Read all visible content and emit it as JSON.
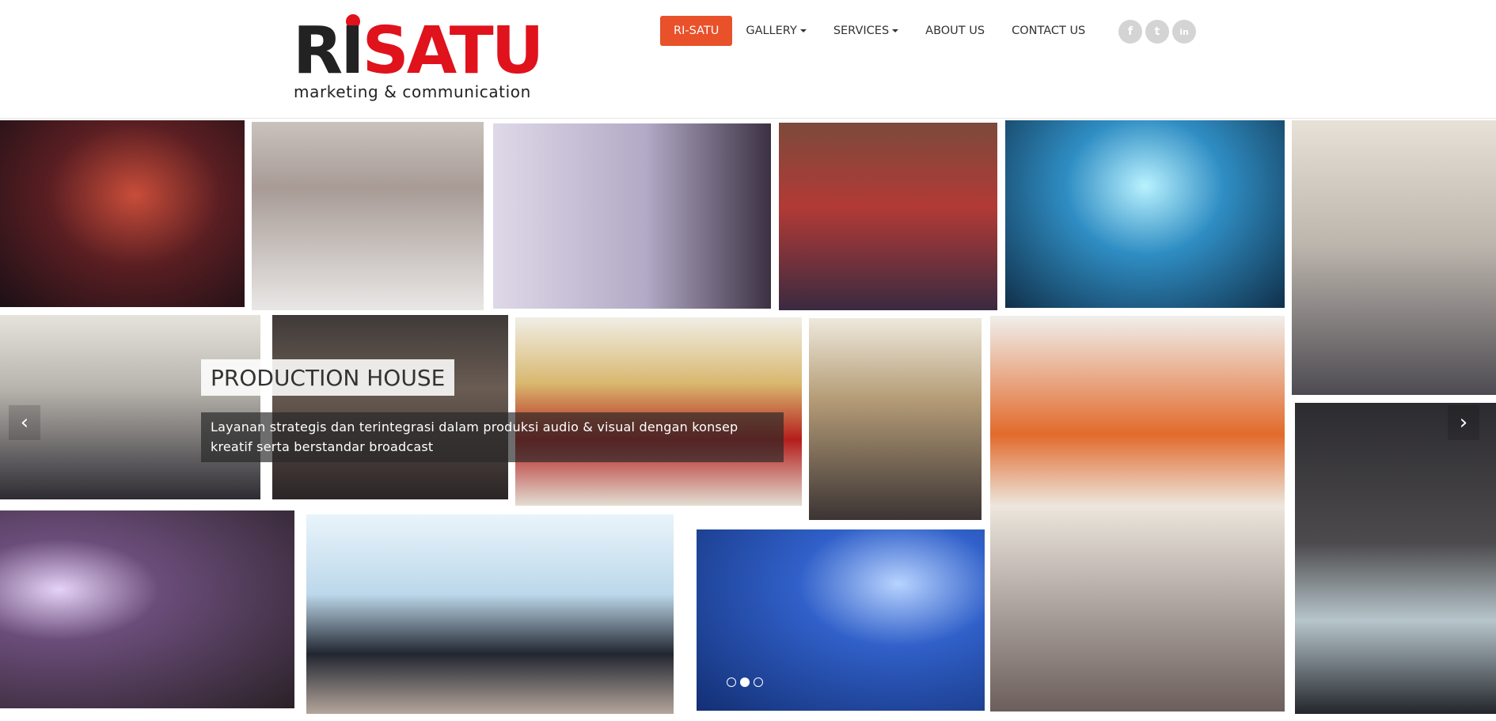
{
  "logo": {
    "wordmark_first": "RI",
    "wordmark_rest": "SATU",
    "tagline": "marketing & communication"
  },
  "nav": {
    "items": [
      {
        "label": "RI-SATU",
        "active": true,
        "dropdown": false
      },
      {
        "label": "GALLERY",
        "active": false,
        "dropdown": true
      },
      {
        "label": "SERVICES",
        "active": false,
        "dropdown": true
      },
      {
        "label": "ABOUT US",
        "active": false,
        "dropdown": false
      },
      {
        "label": "CONTACT US",
        "active": false,
        "dropdown": false
      }
    ]
  },
  "social": {
    "icons": [
      {
        "name": "facebook-icon",
        "glyph": "f"
      },
      {
        "name": "twitter-icon",
        "glyph": "t"
      },
      {
        "name": "linkedin-icon",
        "glyph": "in"
      }
    ]
  },
  "slider": {
    "title": "PRODUCTION HOUSE",
    "description": "Layanan strategis dan terintegrasi dalam produksi audio & visual dengan konsep kreatif serta berstandar broadcast",
    "prev_glyph": "‹",
    "next_glyph": "›",
    "dot_count": 3,
    "active_dot": 2
  },
  "colors": {
    "accent": "#e8512a",
    "brand_red": "#e0121c",
    "social_gray": "#d4d4d4"
  }
}
